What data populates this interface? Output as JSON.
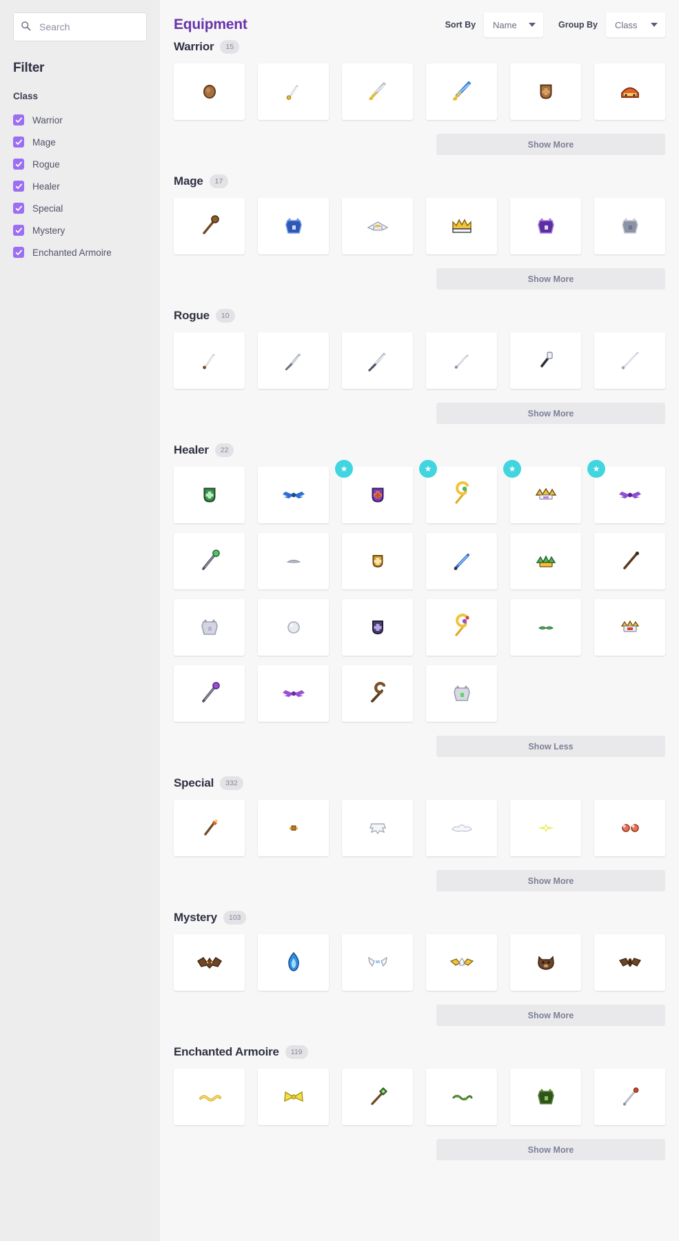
{
  "sidebar": {
    "search": {
      "placeholder": "Search",
      "value": "",
      "icon": "search-icon"
    },
    "filter_title": "Filter",
    "facet_title": "Class",
    "facets": [
      {
        "label": "Warrior",
        "checked": true
      },
      {
        "label": "Mage",
        "checked": true
      },
      {
        "label": "Rogue",
        "checked": true
      },
      {
        "label": "Healer",
        "checked": true
      },
      {
        "label": "Special",
        "checked": true
      },
      {
        "label": "Mystery",
        "checked": true
      },
      {
        "label": "Enchanted Armoire",
        "checked": true
      }
    ]
  },
  "header": {
    "title": "Equipment",
    "sort_by_label": "Sort By",
    "sort_by_value": "Name",
    "group_by_label": "Group By",
    "group_by_value": "Class",
    "caret_icon": "chevron-down-icon"
  },
  "labels": {
    "show_more": "Show More",
    "show_less": "Show Less",
    "star_badge_icon": "star-icon"
  },
  "colors": {
    "accent": "#6633aa",
    "checkbox": "#9b6ef3",
    "badge": "#41d5e0",
    "sidebar_bg": "#ededee",
    "page_bg": "#f7f7f8",
    "card_bg": "#ffffff",
    "showmore_bg": "#e9e9eb"
  },
  "sections": [
    {
      "name": "Warrior",
      "count": "15",
      "toggle": "Show More",
      "items": [
        {
          "icon": "round-wood-shield-icon",
          "starred": false
        },
        {
          "icon": "short-dagger-icon",
          "starred": false
        },
        {
          "icon": "steel-sword-icon",
          "starred": false
        },
        {
          "icon": "blue-broadsword-icon",
          "starred": false
        },
        {
          "icon": "bronze-shield-icon",
          "starred": false
        },
        {
          "icon": "orange-helm-icon",
          "starred": false
        }
      ]
    },
    {
      "name": "Mage",
      "count": "17",
      "toggle": "Show More",
      "items": [
        {
          "icon": "wooden-staff-icon",
          "starred": false
        },
        {
          "icon": "blue-robe-icon",
          "starred": false
        },
        {
          "icon": "white-winged-hat-icon",
          "starred": false
        },
        {
          "icon": "golden-crown-icon",
          "starred": false
        },
        {
          "icon": "purple-robe-icon",
          "starred": false
        },
        {
          "icon": "grey-armor-icon",
          "starred": false
        }
      ]
    },
    {
      "name": "Rogue",
      "count": "10",
      "toggle": "Show More",
      "items": [
        {
          "icon": "slim-dagger-icon",
          "starred": false
        },
        {
          "icon": "grey-dagger-icon",
          "starred": false
        },
        {
          "icon": "long-knife-icon",
          "starred": false
        },
        {
          "icon": "thin-blade-icon",
          "starred": false
        },
        {
          "icon": "short-club-icon",
          "starred": false
        },
        {
          "icon": "rapier-icon",
          "starred": false
        }
      ]
    },
    {
      "name": "Healer",
      "count": "22",
      "toggle": "Show Less",
      "items": [
        {
          "icon": "green-gem-shield-icon",
          "starred": false
        },
        {
          "icon": "blue-wing-accessory-icon",
          "starred": false
        },
        {
          "icon": "purple-cross-shield-icon",
          "starred": true
        },
        {
          "icon": "golden-healing-staff-icon",
          "starred": true
        },
        {
          "icon": "horned-crown-icon",
          "starred": true
        },
        {
          "icon": "violet-wings-icon",
          "starred": true
        },
        {
          "icon": "green-orb-staff-icon",
          "starred": false
        },
        {
          "icon": "small-grey-wing-icon",
          "starred": false
        },
        {
          "icon": "amber-shield-icon",
          "starred": false
        },
        {
          "icon": "blue-wand-icon",
          "starred": false
        },
        {
          "icon": "green-leaf-crown-icon",
          "starred": false
        },
        {
          "icon": "dark-rod-icon",
          "starred": false
        },
        {
          "icon": "silver-armor-icon",
          "starred": false
        },
        {
          "icon": "pearl-orb-icon",
          "starred": false
        },
        {
          "icon": "dark-shield-icon",
          "starred": false
        },
        {
          "icon": "gem-scepter-icon",
          "starred": false
        },
        {
          "icon": "green-sprig-icon",
          "starred": false
        },
        {
          "icon": "teal-helm-icon",
          "starred": false
        },
        {
          "icon": "violet-orb-staff-icon",
          "starred": false
        },
        {
          "icon": "purple-wings-icon",
          "starred": false
        },
        {
          "icon": "brown-cane-icon",
          "starred": false
        },
        {
          "icon": "grey-plate-icon",
          "starred": false
        }
      ]
    },
    {
      "name": "Special",
      "count": "332",
      "toggle": "Show More",
      "items": [
        {
          "icon": "paint-brush-icon",
          "starred": false
        },
        {
          "icon": "tiny-trinket-icon",
          "starred": false
        },
        {
          "icon": "white-skull-icon",
          "starred": false
        },
        {
          "icon": "cloud-wings-icon",
          "starred": false
        },
        {
          "icon": "yellow-sparkle-icon",
          "starred": false
        },
        {
          "icon": "twin-orbs-icon",
          "starred": false
        }
      ]
    },
    {
      "name": "Mystery",
      "count": "103",
      "toggle": "Show More",
      "items": [
        {
          "icon": "brown-bat-icon",
          "starred": false
        },
        {
          "icon": "blue-flame-icon",
          "starred": false
        },
        {
          "icon": "white-wings-icon",
          "starred": false
        },
        {
          "icon": "gold-wings-icon",
          "starred": false
        },
        {
          "icon": "bear-head-icon",
          "starred": false
        },
        {
          "icon": "dark-moth-icon",
          "starred": false
        }
      ]
    },
    {
      "name": "Enchanted Armoire",
      "count": "119",
      "toggle": "Show More",
      "items": [
        {
          "icon": "gold-chain-icon",
          "starred": false
        },
        {
          "icon": "yellow-bow-icon",
          "starred": false
        },
        {
          "icon": "green-mace-icon",
          "starred": false
        },
        {
          "icon": "green-vine-icon",
          "starred": false
        },
        {
          "icon": "dark-green-armor-icon",
          "starred": false
        },
        {
          "icon": "red-tip-wand-icon",
          "starred": false
        }
      ]
    }
  ]
}
